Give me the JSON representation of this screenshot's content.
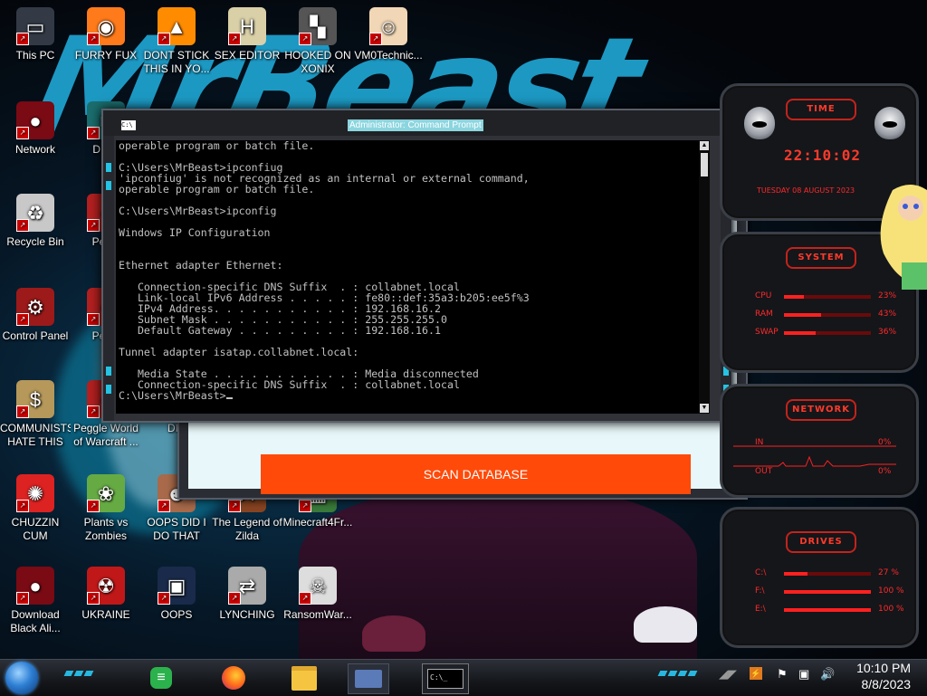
{
  "desktop": {
    "icons": [
      {
        "label": "This PC",
        "icon": "this-pc-icon"
      },
      {
        "label": "FURRY FUX",
        "icon": "firefox-icon"
      },
      {
        "label": "DONT STICK THIS IN YO...",
        "icon": "vlc-cone-icon"
      },
      {
        "label": "SEX EDITOR",
        "icon": "hxd-editor-icon"
      },
      {
        "label": "HOOKED ON XONIX",
        "icon": "xonix-game-icon"
      },
      {
        "label": "VM0Technic...",
        "icon": "doctor-icon"
      },
      {
        "label": "Network",
        "icon": "network-icon"
      },
      {
        "label": "D DU",
        "icon": "app-icon"
      },
      {
        "label": "Recycle Bin",
        "icon": "recycle-bin-icon"
      },
      {
        "label": "Peggl",
        "icon": "peggle-icon"
      },
      {
        "label": "Control Panel",
        "icon": "control-panel-icon"
      },
      {
        "label": "Peggl",
        "icon": "peggle-icon"
      },
      {
        "label": "COMMUNISTS HATE THIS G...",
        "icon": "money-bag-icon"
      },
      {
        "label": "Peggle World of Warcraft ...",
        "icon": "peggle-icon"
      },
      {
        "label": "DIE",
        "icon": "app-icon"
      },
      {
        "label": "CHUZZIN CUM",
        "icon": "chuzzle-icon"
      },
      {
        "label": "Plants vs Zombies",
        "icon": "plants-vs-zombies-icon"
      },
      {
        "label": "OOPS DID I DO THAT",
        "icon": "portrait-icon"
      },
      {
        "label": "The Legend of Zilda",
        "icon": "zelda-icon"
      },
      {
        "label": "Minecraft4Fr...",
        "icon": "minecraft-icon"
      },
      {
        "label": "Download Black Ali...",
        "icon": "network-icon"
      },
      {
        "label": "UKRAINE",
        "icon": "radiation-icon"
      },
      {
        "label": "OOPS",
        "icon": "monitor-icon"
      },
      {
        "label": "LYNCHING",
        "icon": "network-share-icon"
      },
      {
        "label": "RansomWar...",
        "icon": "skull-icon"
      }
    ]
  },
  "scanner_app": {
    "button_label": "SCAN DATABASE"
  },
  "cmd": {
    "title": "Administrator: Command Prompt",
    "icon_text": "C:\\",
    "lines": [
      "operable program or batch file.",
      "",
      "C:\\Users\\MrBeast>ipconfiug",
      "'ipconfiug' is not recognized as an internal or external command,",
      "operable program or batch file.",
      "",
      "C:\\Users\\MrBeast>ipconfig",
      "",
      "Windows IP Configuration",
      "",
      "",
      "Ethernet adapter Ethernet:",
      "",
      "   Connection-specific DNS Suffix  . : collabnet.local",
      "   Link-local IPv6 Address . . . . . : fe80::def:35a3:b205:ee5f%3",
      "   IPv4 Address. . . . . . . . . . . : 192.168.16.2",
      "   Subnet Mask . . . . . . . . . . . : 255.255.255.0",
      "   Default Gateway . . . . . . . . . : 192.168.16.1",
      "",
      "Tunnel adapter isatap.collabnet.local:",
      "",
      "   Media State . . . . . . . . . . . : Media disconnected",
      "   Connection-specific DNS Suffix  . : collabnet.local",
      ""
    ],
    "prompt": "C:\\Users\\MrBeast>"
  },
  "widgets": {
    "time": {
      "header": "TIME",
      "clock": "22:10:02",
      "date": "TUESDAY 08 AUGUST 2023"
    },
    "system": {
      "header": "SYSTEM",
      "rows": [
        {
          "label": "CPU",
          "value": "23%",
          "level": 0.23
        },
        {
          "label": "RAM",
          "value": "43%",
          "level": 0.43
        },
        {
          "label": "SWAP",
          "value": "36%",
          "level": 0.36
        }
      ]
    },
    "network": {
      "header": "NETWORK",
      "rows": [
        {
          "label": "IN",
          "value": "0%"
        },
        {
          "label": "OUT",
          "value": "0%"
        }
      ]
    },
    "drives": {
      "header": "DRIVES",
      "rows": [
        {
          "label": "C:\\",
          "value": "27 %",
          "level": 0.27
        },
        {
          "label": "F:\\",
          "value": "100 %",
          "level": 1.0
        },
        {
          "label": "E:\\",
          "value": "100 %",
          "level": 1.0
        }
      ]
    }
  },
  "taskbar": {
    "apps": [
      {
        "name": "start-orb",
        "icon": "windows-orb-icon"
      },
      {
        "name": "feedly",
        "icon": "feedly-icon"
      },
      {
        "name": "firefox",
        "icon": "firefox-icon"
      },
      {
        "name": "file-explorer",
        "icon": "folder-icon"
      },
      {
        "name": "server-manager",
        "icon": "server-icon"
      },
      {
        "name": "command-prompt",
        "icon": "cmd-icon",
        "label": "C:\\_"
      }
    ],
    "tray": {
      "time": "10:10 PM",
      "date": "8/8/2023"
    }
  },
  "colors": {
    "accent_cyan": "#24c4e4",
    "scan_button": "#ff4a0a",
    "widget_red": "#ff2a2a"
  }
}
